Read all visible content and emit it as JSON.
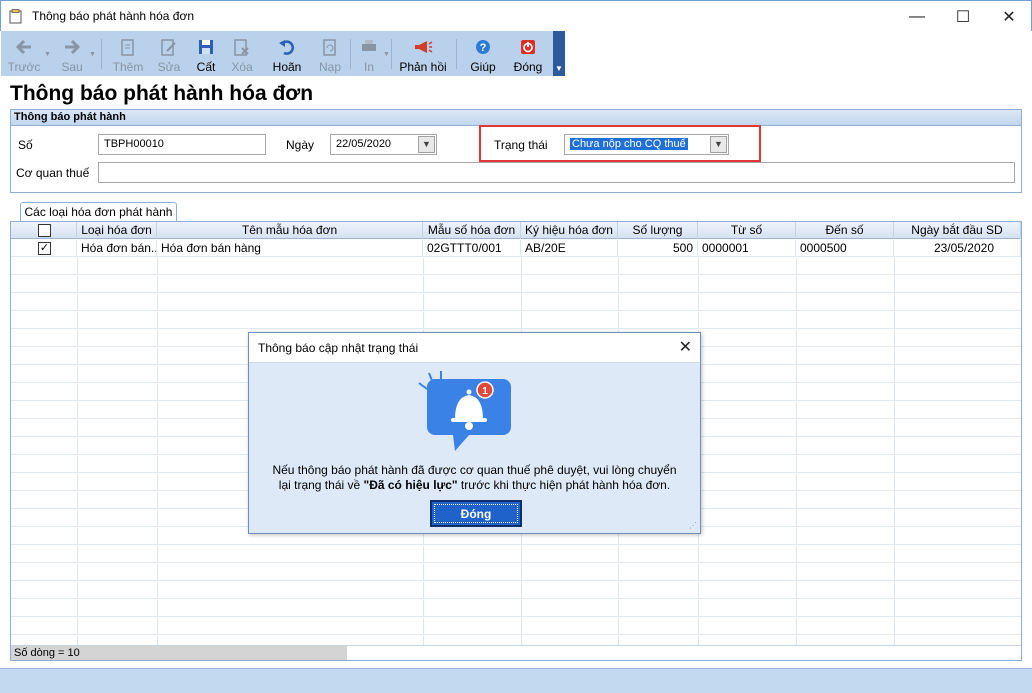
{
  "window": {
    "title": "Thông báo phát hành hóa đơn",
    "minimize": "—",
    "maximize": "☐",
    "close": "✕"
  },
  "toolbar": {
    "buttons": [
      {
        "label": "Trước",
        "icon": "arrow-left-icon",
        "enabled": false
      },
      {
        "label": "Sau",
        "icon": "arrow-right-icon",
        "enabled": false
      },
      {
        "label": "Thêm",
        "icon": "add-icon",
        "enabled": false
      },
      {
        "label": "Sửa",
        "icon": "edit-icon",
        "enabled": false
      },
      {
        "label": "Cất",
        "icon": "save-icon",
        "enabled": true
      },
      {
        "label": "Xóa",
        "icon": "delete-icon",
        "enabled": false
      },
      {
        "label": "Hoãn",
        "icon": "undo-icon",
        "enabled": true
      },
      {
        "label": "Nạp",
        "icon": "reload-icon",
        "enabled": false
      },
      {
        "label": "In",
        "icon": "print-icon",
        "enabled": false
      },
      {
        "label": "Phản hồi",
        "icon": "megaphone-icon",
        "enabled": true
      },
      {
        "label": "Giúp",
        "icon": "help-icon",
        "enabled": true
      },
      {
        "label": "Đóng",
        "icon": "power-icon",
        "enabled": true
      }
    ]
  },
  "page_title": "Thông báo phát hành hóa đơn",
  "section": {
    "title": "Thông báo phát hành",
    "so_label": "Số",
    "so_value": "TBPH00010",
    "ngay_label": "Ngày",
    "ngay_value": "22/05/2020",
    "trang_thai_label": "Trạng thái",
    "trang_thai_value": "Chưa nộp cho CQ thuế",
    "co_quan_thue_label": "Cơ quan thuế",
    "co_quan_thue_value": ""
  },
  "tab": {
    "label": "Các loại hóa đơn phát hành"
  },
  "grid": {
    "columns": [
      "",
      "Loại hóa đơn",
      "Tên mẫu hóa đơn",
      "Mẫu số hóa đơn",
      "Ký hiệu hóa đơn",
      "Số lượng",
      "Từ số",
      "Đến số",
      "Ngày bắt đầu SD"
    ],
    "rows": [
      {
        "checked": true,
        "loai": "Hóa đơn bán...",
        "ten_mau": "Hóa đơn bán hàng",
        "mau_so": "02GTTT0/001",
        "ky_hieu": "AB/20E",
        "so_luong": "500",
        "tu_so": "0000001",
        "den_so": "0000500",
        "ngay_bd": "23/05/2020"
      }
    ],
    "footer": "Số dòng = 10"
  },
  "dialog": {
    "title": "Thông báo cập nhật trạng thái",
    "badge": "1",
    "message_line1": "Nếu thông báo phát hành đã được cơ quan thuế phê duyệt, vui lòng chuyển",
    "message_line2_prefix": "lại trạng thái về ",
    "message_line2_bold": "\"Đã có hiệu lực\"",
    "message_line2_suffix": " trước khi thực hiện phát hành hóa đơn.",
    "button": "Đóng"
  },
  "colors": {
    "toolbar_bg": "#b9d1ea",
    "highlight_border": "#e0383a",
    "dialog_bg": "#dde9f7",
    "primary_button": "#1f62c9",
    "bell_panel": "#3b82e6"
  }
}
